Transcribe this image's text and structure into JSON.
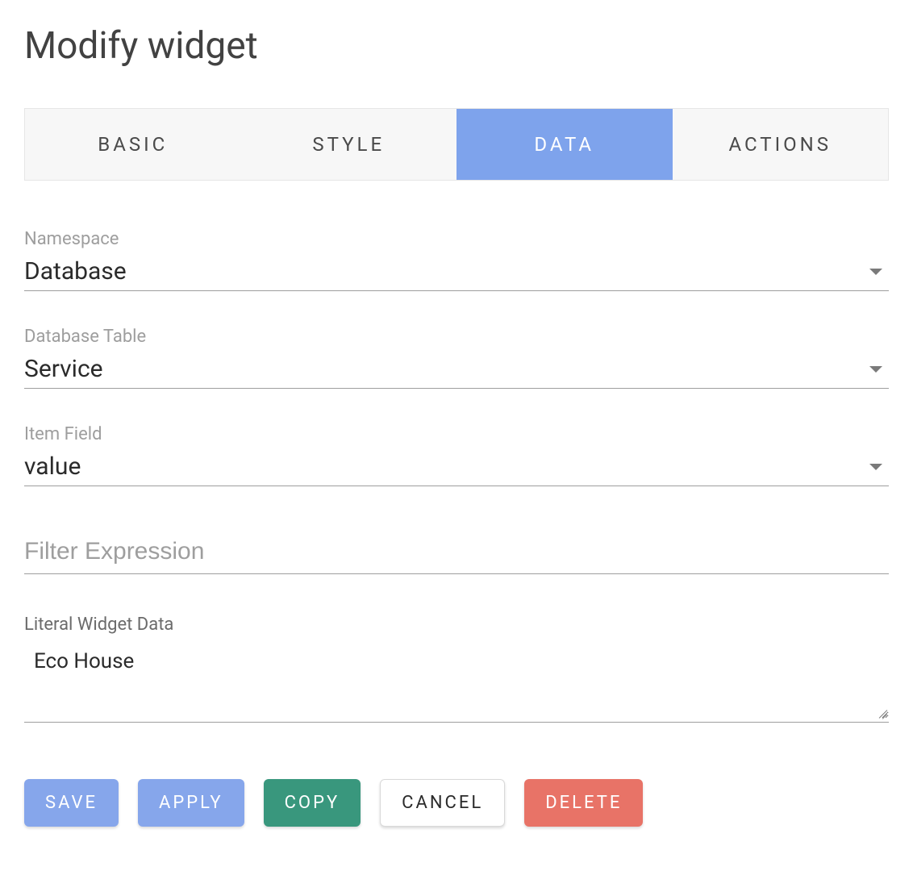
{
  "header": {
    "title": "Modify widget"
  },
  "tabs": {
    "basic": "BASIC",
    "style": "STYLE",
    "data": "DATA",
    "actions": "ACTIONS",
    "active": "data"
  },
  "fields": {
    "namespace": {
      "label": "Namespace",
      "value": "Database"
    },
    "database_table": {
      "label": "Database Table",
      "value": "Service"
    },
    "item_field": {
      "label": "Item Field",
      "value": "value"
    },
    "filter_expression": {
      "placeholder": "Filter Expression",
      "value": ""
    },
    "literal_widget_data": {
      "label": "Literal Widget Data",
      "value": "Eco House"
    }
  },
  "buttons": {
    "save": "SAVE",
    "apply": "APPLY",
    "copy": "COPY",
    "cancel": "CANCEL",
    "delete": "DELETE"
  }
}
